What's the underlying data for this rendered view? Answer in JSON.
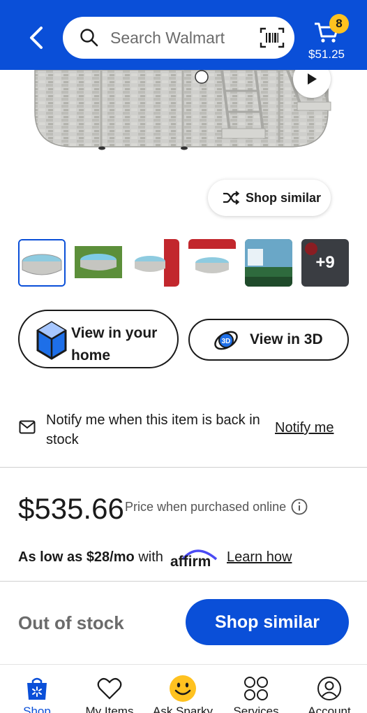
{
  "header": {
    "search_placeholder": "Search Walmart",
    "cart_count": "8",
    "cart_total": "$51.25"
  },
  "hero": {
    "shop_similar_chip": "Shop similar"
  },
  "thumbnails": {
    "more_count": "+9"
  },
  "view_buttons": {
    "home_line1": "View in your",
    "home_line2": "home",
    "three_d": "View in 3D"
  },
  "notify": {
    "message": "Notify me when this item is back in stock",
    "link": "Notify me"
  },
  "price": {
    "amount": "$535.66",
    "note": "Price when purchased online"
  },
  "financing": {
    "prefix": "As low as $28/mo",
    "with": "with",
    "learn_how": "Learn how"
  },
  "cta": {
    "status": "Out of stock",
    "button": "Shop similar"
  },
  "bottom_nav": {
    "items": [
      {
        "label": "Shop",
        "icon": "spark-bag-icon"
      },
      {
        "label": "My Items",
        "icon": "heart-icon"
      },
      {
        "label": "Ask Sparky",
        "icon": "sparky-icon"
      },
      {
        "label": "Services",
        "icon": "grid-circles-icon"
      },
      {
        "label": "Account",
        "icon": "person-icon"
      }
    ]
  },
  "colors": {
    "brand_blue": "#0a4fd8",
    "badge_yellow": "#ffc220"
  }
}
